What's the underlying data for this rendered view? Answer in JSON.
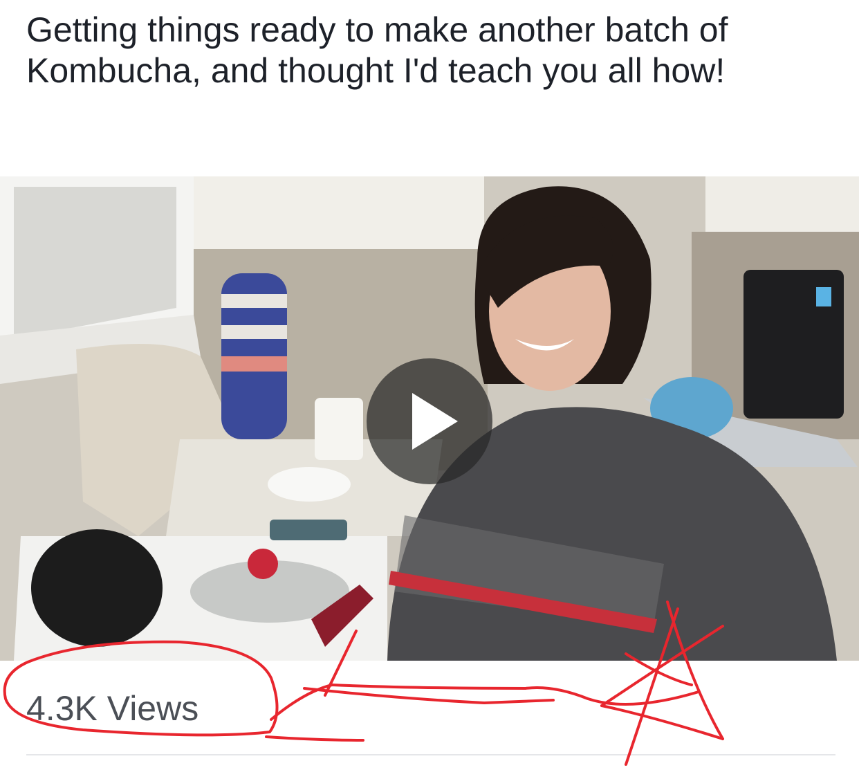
{
  "post": {
    "text": "Getting things ready to make another batch of Kombucha, and thought I'd teach you all how!"
  },
  "video": {
    "thumbnail": "Woman in a kitchen wearing a Nebraska Huskers t-shirt, standing by a stove",
    "play_icon": "play-icon"
  },
  "stats": {
    "views": "4.3K Views"
  },
  "colors": {
    "annotation_red": "#e8262e",
    "text": "#1d2129",
    "subtext": "#4b4f56"
  }
}
